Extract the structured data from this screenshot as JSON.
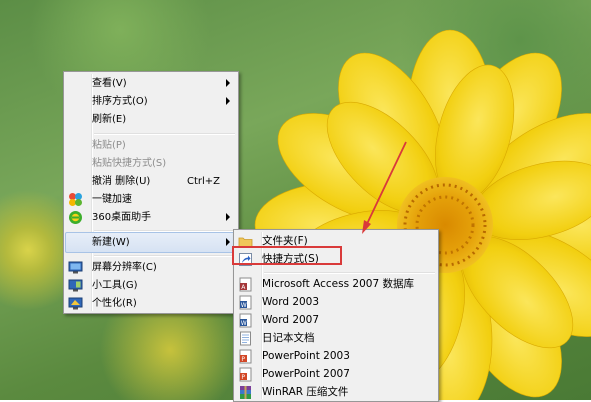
{
  "main_menu": {
    "items": [
      {
        "label": "查看(V)",
        "submenu": true
      },
      {
        "label": "排序方式(O)",
        "submenu": true
      },
      {
        "label": "刷新(E)"
      },
      {
        "label": "粘贴(P)",
        "disabled": true
      },
      {
        "label": "粘贴快捷方式(S)",
        "disabled": true
      },
      {
        "label": "撤消 删除(U)",
        "shortcut": "Ctrl+Z"
      },
      {
        "label": "一键加速",
        "icon": "clover-accelerate-icon"
      },
      {
        "label": "360桌面助手",
        "icon": "360-assistant-icon",
        "submenu": true
      },
      {
        "label": "新建(W)",
        "submenu": true,
        "highlighted": true
      },
      {
        "label": "屏幕分辨率(C)",
        "icon": "screen-resolution-icon"
      },
      {
        "label": "小工具(G)",
        "icon": "gadgets-icon"
      },
      {
        "label": "个性化(R)",
        "icon": "personalize-icon"
      }
    ]
  },
  "sub_menu": {
    "items": [
      {
        "label": "文件夹(F)",
        "icon": "folder-icon"
      },
      {
        "label": "快捷方式(S)",
        "icon": "shortcut-icon",
        "annotated": true
      },
      {
        "label": "Microsoft Access 2007 数据库",
        "icon": "access-icon"
      },
      {
        "label": "Word 2003",
        "icon": "word-doc-icon"
      },
      {
        "label": "Word 2007",
        "icon": "word-doc-icon"
      },
      {
        "label": "日记本文档",
        "icon": "journal-icon"
      },
      {
        "label": "PowerPoint 2003",
        "icon": "powerpoint-icon"
      },
      {
        "label": "PowerPoint 2007",
        "icon": "powerpoint-icon"
      },
      {
        "label": "WinRAR 压缩文件",
        "icon": "winrar-icon"
      }
    ]
  },
  "colors": {
    "menu_bg": "#f0f0f0",
    "highlight": "#d6e2f3",
    "annotation_red": "#d93a3a",
    "flower_yellow": "#f4d21c"
  }
}
